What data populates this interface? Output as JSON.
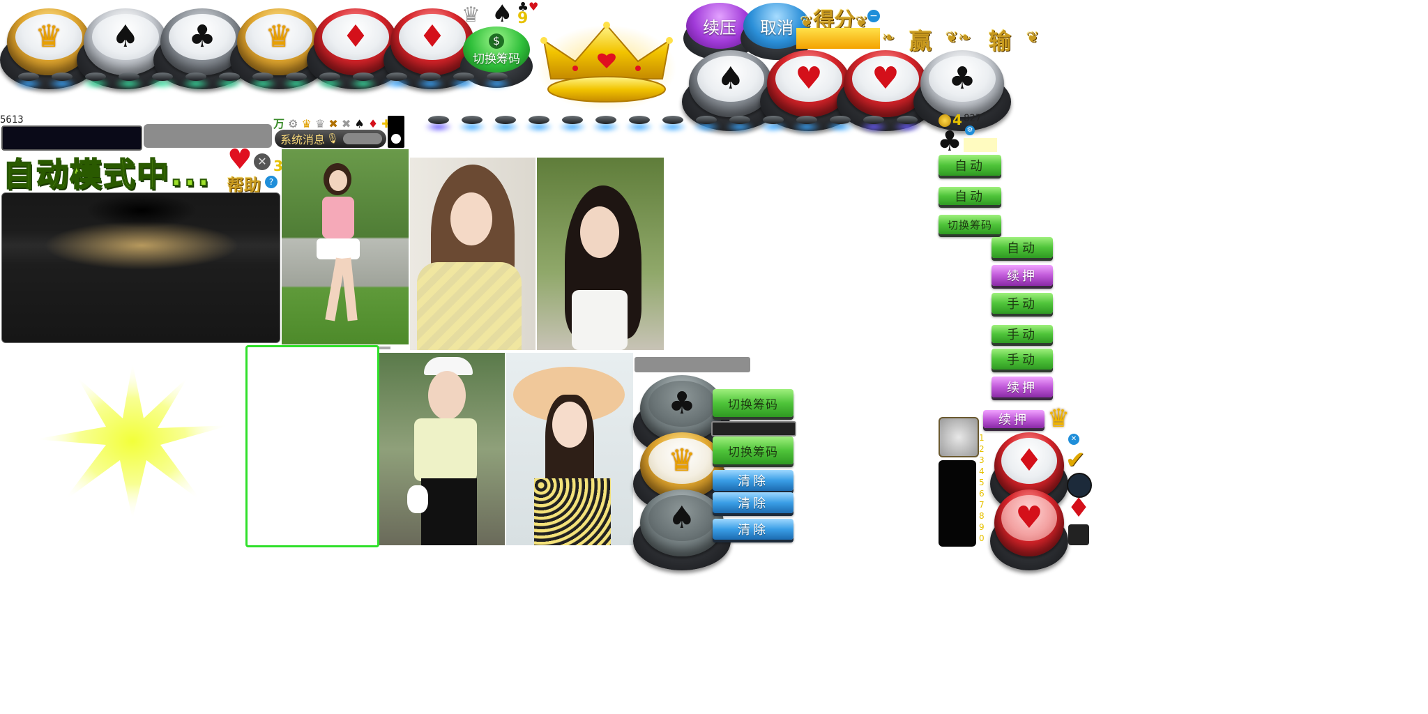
{
  "chip_buttons_row1": [
    {
      "symbol": "♛",
      "color": "gold"
    },
    {
      "symbol": "♠",
      "color": "silver"
    },
    {
      "symbol": "♣",
      "color": "dark"
    },
    {
      "symbol": "♛",
      "color": "gold"
    },
    {
      "symbol": "♦",
      "color": "red"
    },
    {
      "symbol": "♦",
      "color": "red"
    }
  ],
  "chip_buttons_row2": [
    {
      "symbol": "♠",
      "color": "dark"
    },
    {
      "symbol": "♥",
      "color": "red"
    },
    {
      "symbol": "♥",
      "color": "red"
    },
    {
      "symbol": "♣",
      "color": "silver"
    }
  ],
  "switch_chip_round_label": "切换筹码",
  "dollar_sign": "$",
  "small_digit_top": "9",
  "buttons": {
    "continue_bet_label": "续压",
    "cancel_label": "取消"
  },
  "score": {
    "label": "得分",
    "win_label": "赢",
    "lose_label": "输"
  },
  "counters": {
    "left_value": "5613",
    "right_value": "827",
    "wan_char": "万",
    "small_four": "4",
    "right_four": "4"
  },
  "system_message_label": "系统消息",
  "auto_mode_text": "自动模式中...",
  "help_label": "帮助",
  "side_digits": "3",
  "right_panel_buttons": [
    {
      "label": "自动",
      "style": "green"
    },
    {
      "label": "自动",
      "style": "green"
    },
    {
      "label": "切换筹码",
      "style": "green"
    }
  ],
  "right_stack_buttons": [
    {
      "label": "自动",
      "style": "green"
    },
    {
      "label": "续押",
      "style": "violet"
    },
    {
      "label": "手动",
      "style": "green"
    },
    {
      "label": "手动",
      "style": "green"
    },
    {
      "label": "手动",
      "style": "green"
    },
    {
      "label": "续押",
      "style": "violet"
    },
    {
      "label": "续押",
      "style": "violet"
    }
  ],
  "middle_buttons": [
    {
      "label": "切换筹码",
      "style": "green"
    },
    {
      "label": "切换筹码",
      "style": "green"
    },
    {
      "label": "清除",
      "style": "sky"
    },
    {
      "label": "清除",
      "style": "sky"
    },
    {
      "label": "清除",
      "style": "sky"
    }
  ],
  "bottom_chip_buttons": [
    {
      "symbol": "♣",
      "color": "slate"
    },
    {
      "symbol": "♛",
      "color": "gold"
    },
    {
      "symbol": "♠",
      "color": "slate"
    }
  ],
  "bottom_right_chip_buttons": [
    {
      "symbol": "♦",
      "color": "red"
    },
    {
      "symbol": "♥",
      "color": "red"
    }
  ],
  "vertical_digits": "1234567890",
  "checkmark": "✔"
}
